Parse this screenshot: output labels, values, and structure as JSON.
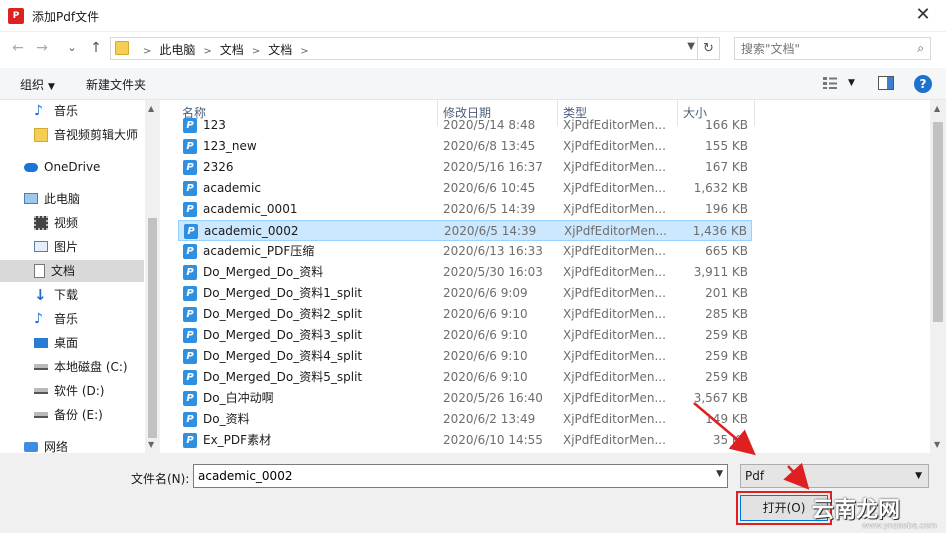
{
  "window": {
    "title": "添加Pdf文件",
    "app_icon_text": "P",
    "close_label": "✕"
  },
  "nav": {
    "back": "←",
    "forward": "→",
    "recent": "⌄",
    "up": "↑"
  },
  "address": {
    "crumbs": [
      "此电脑",
      "文档",
      "文档"
    ],
    "refresh": "↻"
  },
  "search": {
    "placeholder": "搜索\"文档\"",
    "icon": "search-icon"
  },
  "toolbar": {
    "organize": "组织",
    "new_folder": "新建文件夹",
    "help": "?"
  },
  "sidebar": {
    "items": [
      {
        "label": "音乐",
        "icon": "music-icon"
      },
      {
        "label": "音视频剪辑大师",
        "icon": "folder-icon"
      },
      {
        "label": "OneDrive",
        "icon": "cloud-icon"
      },
      {
        "label": "此电脑",
        "icon": "computer-icon"
      },
      {
        "label": "视频",
        "icon": "video-icon"
      },
      {
        "label": "图片",
        "icon": "picture-icon"
      },
      {
        "label": "文档",
        "icon": "document-icon"
      },
      {
        "label": "下载",
        "icon": "download-icon"
      },
      {
        "label": "音乐",
        "icon": "music-icon"
      },
      {
        "label": "桌面",
        "icon": "desktop-icon"
      },
      {
        "label": "本地磁盘 (C:)",
        "icon": "drive-icon"
      },
      {
        "label": "软件 (D:)",
        "icon": "drive-icon"
      },
      {
        "label": "备份 (E:)",
        "icon": "drive-icon"
      },
      {
        "label": "网络",
        "icon": "network-icon"
      }
    ]
  },
  "columns": {
    "name": "名称",
    "date": "修改日期",
    "type": "类型",
    "size": "大小"
  },
  "files": [
    {
      "name": "123",
      "date": "2020/5/14 8:48",
      "type": "XjPdfEditorMen...",
      "size": "166 KB"
    },
    {
      "name": "123_new",
      "date": "2020/6/8 13:45",
      "type": "XjPdfEditorMen...",
      "size": "155 KB"
    },
    {
      "name": "2326",
      "date": "2020/5/16 16:37",
      "type": "XjPdfEditorMen...",
      "size": "167 KB"
    },
    {
      "name": "academic",
      "date": "2020/6/6 10:45",
      "type": "XjPdfEditorMen...",
      "size": "1,632 KB"
    },
    {
      "name": "academic_0001",
      "date": "2020/6/5 14:39",
      "type": "XjPdfEditorMen...",
      "size": "196 KB"
    },
    {
      "name": "academic_0002",
      "date": "2020/6/5 14:39",
      "type": "XjPdfEditorMen...",
      "size": "1,436 KB"
    },
    {
      "name": "academic_PDF压缩",
      "date": "2020/6/13 16:33",
      "type": "XjPdfEditorMen...",
      "size": "665 KB"
    },
    {
      "name": "Do_Merged_Do_资料",
      "date": "2020/5/30 16:03",
      "type": "XjPdfEditorMen...",
      "size": "3,911 KB"
    },
    {
      "name": "Do_Merged_Do_资料1_split",
      "date": "2020/6/6 9:09",
      "type": "XjPdfEditorMen...",
      "size": "201 KB"
    },
    {
      "name": "Do_Merged_Do_资料2_split",
      "date": "2020/6/6 9:10",
      "type": "XjPdfEditorMen...",
      "size": "285 KB"
    },
    {
      "name": "Do_Merged_Do_资料3_split",
      "date": "2020/6/6 9:10",
      "type": "XjPdfEditorMen...",
      "size": "259 KB"
    },
    {
      "name": "Do_Merged_Do_资料4_split",
      "date": "2020/6/6 9:10",
      "type": "XjPdfEditorMen...",
      "size": "259 KB"
    },
    {
      "name": "Do_Merged_Do_资料5_split",
      "date": "2020/6/6 9:10",
      "type": "XjPdfEditorMen...",
      "size": "259 KB"
    },
    {
      "name": "Do_白冲动啊",
      "date": "2020/5/26 16:40",
      "type": "XjPdfEditorMen...",
      "size": "3,567 KB"
    },
    {
      "name": "Do_资料",
      "date": "2020/6/2 13:49",
      "type": "XjPdfEditorMen...",
      "size": "149 KB"
    },
    {
      "name": "Ex_PDF素材",
      "date": "2020/6/10 14:55",
      "type": "XjPdfEditorMen...",
      "size": "35 KB"
    }
  ],
  "selected_index": 5,
  "footer": {
    "filename_label": "文件名(N):",
    "filename_value": "academic_0002",
    "filetype": "Pdf",
    "open_label": "打开(O)"
  },
  "watermark": {
    "text": "云南龙网",
    "url": "www.ynzaoba.com"
  },
  "colors": {
    "selection": "#cce8ff",
    "accent": "#0078d7",
    "annotation": "#e02020"
  }
}
